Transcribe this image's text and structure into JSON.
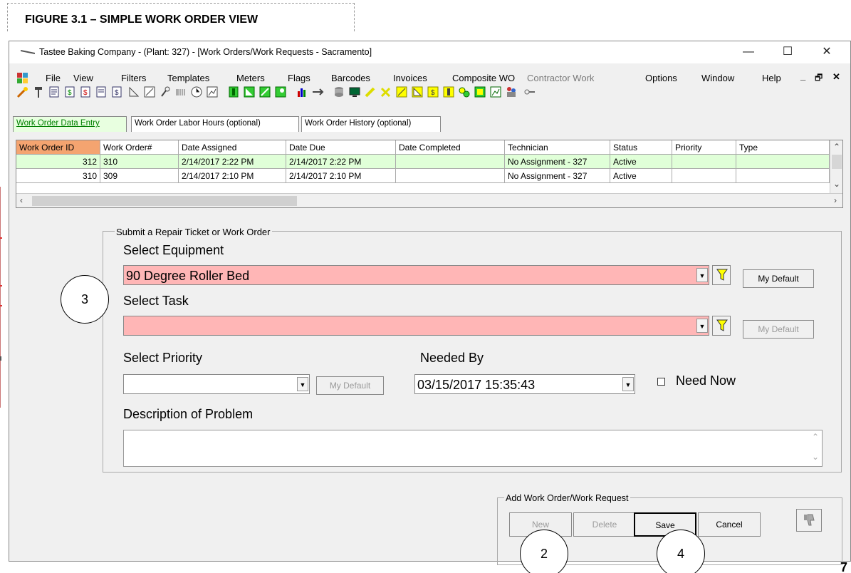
{
  "figure_caption": "FIGURE 3.1 – SIMPLE WORK ORDER VIEW",
  "window": {
    "title": "Tastee Baking Company - (Plant: 327) - [Work Orders/Work Requests - Sacramento]",
    "minimize": "—",
    "maximize": "☐",
    "close": "✕",
    "mdi_minimize": "_",
    "mdi_restore": "🗗",
    "mdi_close": "✕"
  },
  "menu": {
    "items": [
      "File",
      "View",
      "Filters",
      "Templates",
      "Meters",
      "Flags",
      "Barcodes",
      "Invoices",
      "Composite WO",
      "Contractor Work",
      "Options",
      "Window",
      "Help"
    ],
    "disabled": [
      "Contractor Work"
    ]
  },
  "tabs": [
    "Work Order Data Entry",
    "Work Order Labor Hours (optional)",
    "Work Order History (optional)"
  ],
  "grid": {
    "columns": [
      "Work Order ID",
      "Work Order#",
      "Date Assigned",
      "Date Due",
      "Date Completed",
      "Technician",
      "Status",
      "Priority",
      "Type"
    ],
    "rows": [
      [
        "312",
        "310",
        "2/14/2017 2:22 PM",
        "2/14/2017 2:22 PM",
        "",
        "No Assignment - 327",
        "Active",
        "",
        ""
      ],
      [
        "310",
        "309",
        "2/14/2017 2:10 PM",
        "2/14/2017 2:10 PM",
        "",
        "No Assignment - 327",
        "Active",
        "",
        ""
      ]
    ]
  },
  "form": {
    "group_title": "Submit a Repair Ticket or Work Order",
    "equipment_label": "Select Equipment",
    "equipment_value": "90 Degree Roller Bed",
    "task_label": "Select Task",
    "task_value": "",
    "priority_label": "Select Priority",
    "priority_value": "",
    "needed_by_label": "Needed By",
    "needed_by_value": "03/15/2017 15:35:43",
    "need_now_label": "Need Now",
    "description_label": "Description of Problem",
    "description_value": "",
    "my_default": "My Default"
  },
  "actions": {
    "group_title": "Add Work Order/Work Request",
    "new": "New",
    "delete": "Delete",
    "save": "Save",
    "cancel": "Cancel"
  },
  "callouts": {
    "c3": "3",
    "c2": "2",
    "c4": "4"
  },
  "page_number": "7",
  "colors": {
    "required_field": "#ffb6b6",
    "selected_row": "#e0ffd8",
    "header_highlight": "#f4a470",
    "active_tab_text": "#008000"
  }
}
